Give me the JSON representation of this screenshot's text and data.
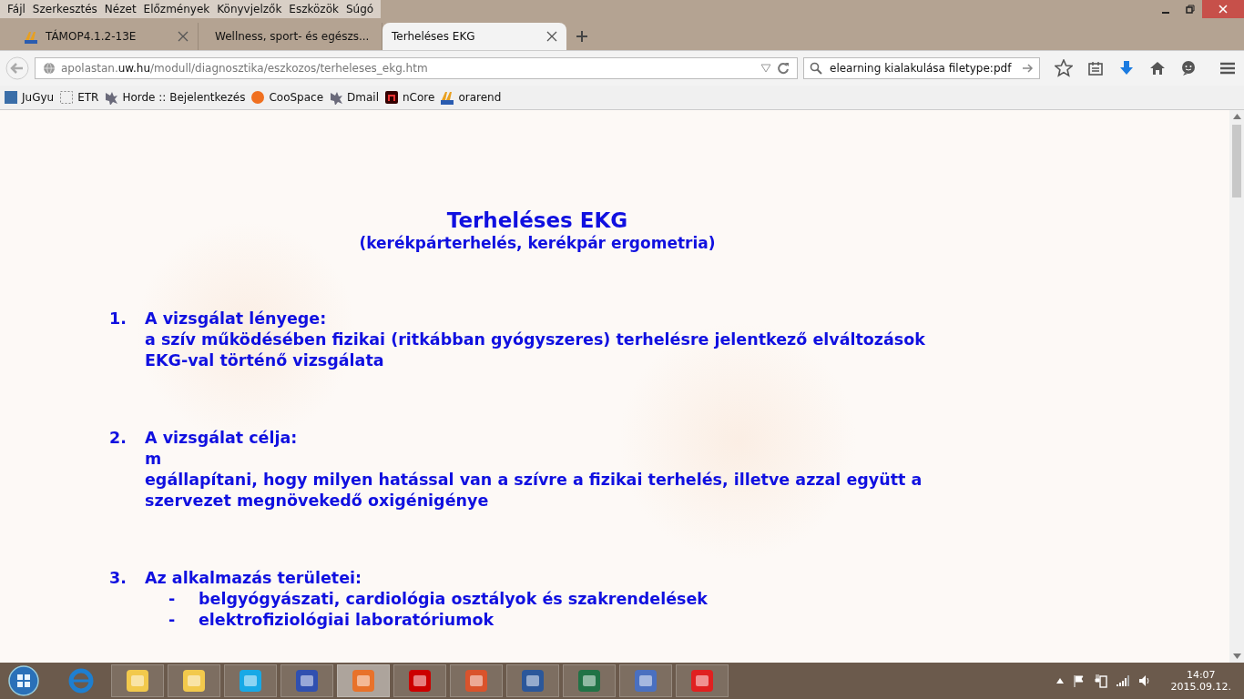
{
  "menu": [
    "Fájl",
    "Szerkesztés",
    "Nézet",
    "Előzmények",
    "Könyvjelzők",
    "Eszközök",
    "Súgó"
  ],
  "tabs": [
    {
      "title": "TÁMOP4.1.2-13E",
      "selected": false
    },
    {
      "title": "Wellness, sport- és egészs...",
      "selected": false
    },
    {
      "title": "Terheléses EKG",
      "selected": true
    }
  ],
  "address": {
    "value": "apolastan.**uw.hu**/modull/diagnosztika/eszkozos/terheleses_ekg.htm"
  },
  "search": {
    "value": "elearning kialakulása filetype:pdf"
  },
  "bookmarks": [
    "JuGyu",
    "ETR",
    "Horde :: Bejelentkezés",
    "CooSpace",
    "Dmail",
    "nCore",
    "orarend"
  ],
  "page": {
    "title": "Terheléses EKG",
    "subtitle": "(kerékpárterhelés, kerékpár ergometria)",
    "sections": [
      {
        "number": "1.",
        "heading": "A vizsgálat lényege:",
        "lines": [
          "a szív működésében fizikai (ritkábban gyógyszeres) terhelésre jelentkező  elváltozások",
          "EKG-val történő vizsgálata"
        ]
      },
      {
        "number": "2.",
        "heading": "A vizsgálat célja:",
        "lines": [
          "m",
          "egállapítani, hogy milyen hatással van a szívre a fizikai terhelés, illetve azzal együtt a",
          "szervezet megnövekedő oxigénigénye"
        ]
      },
      {
        "number": "3.",
        "heading": "Az alkalmazás területei:",
        "items": [
          {
            "bullet": "-",
            "text": "belgyógyászati, cardiológia osztályok és szakrendelések"
          },
          {
            "bullet": "-",
            "text": "elektrofiziológiai laboratóriumok"
          }
        ]
      }
    ]
  },
  "clock": {
    "time": "14:07",
    "date": "2015.09.12."
  }
}
